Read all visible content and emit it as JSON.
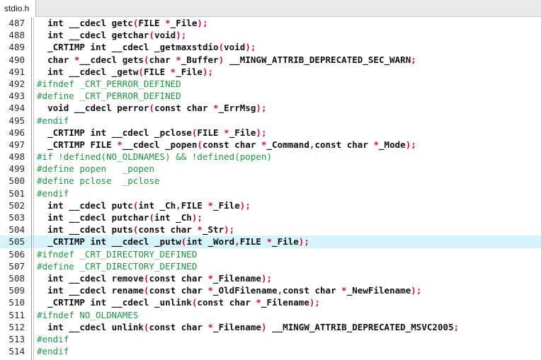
{
  "window": {
    "app": "code-editor",
    "colors": {
      "tabbar_bg": "#e9e9e9",
      "active_tab_bg": "#ffffff",
      "editor_bg": "#ffffff",
      "current_line_highlight": "#d6f4fb",
      "line_number": "#2b2b2b",
      "keyword": "#101010",
      "punctuation": "#d01030",
      "preprocessor": "#1a9641"
    }
  },
  "tabs": [
    {
      "label": "stdio.h",
      "active": true
    }
  ],
  "editor": {
    "language": "c-header",
    "first_visible_line": 487,
    "last_visible_line": 514,
    "current_line": 505,
    "lines": [
      {
        "num": "487",
        "text": "  int __cdecl getc(FILE *_File);"
      },
      {
        "num": "488",
        "text": "  int __cdecl getchar(void);"
      },
      {
        "num": "489",
        "text": "  _CRTIMP int __cdecl _getmaxstdio(void);"
      },
      {
        "num": "490",
        "text": "  char *__cdecl gets(char *_Buffer) __MINGW_ATTRIB_DEPRECATED_SEC_WARN;"
      },
      {
        "num": "491",
        "text": "  int __cdecl _getw(FILE *_File);"
      },
      {
        "num": "492",
        "text": "#ifndef _CRT_PERROR_DEFINED"
      },
      {
        "num": "493",
        "text": "#define _CRT_PERROR_DEFINED"
      },
      {
        "num": "494",
        "text": "  void __cdecl perror(const char *_ErrMsg);"
      },
      {
        "num": "495",
        "text": "#endif"
      },
      {
        "num": "496",
        "text": "  _CRTIMP int __cdecl _pclose(FILE *_File);"
      },
      {
        "num": "497",
        "text": "  _CRTIMP FILE *__cdecl _popen(const char *_Command,const char *_Mode);"
      },
      {
        "num": "498",
        "text": "#if !defined(NO_OLDNAMES) && !defined(popen)"
      },
      {
        "num": "499",
        "text": "#define popen   _popen"
      },
      {
        "num": "500",
        "text": "#define pclose  _pclose"
      },
      {
        "num": "501",
        "text": "#endif"
      },
      {
        "num": "502",
        "text": "  int __cdecl putc(int _Ch,FILE *_File);"
      },
      {
        "num": "503",
        "text": "  int __cdecl putchar(int _Ch);"
      },
      {
        "num": "504",
        "text": "  int __cdecl puts(const char *_Str);"
      },
      {
        "num": "505",
        "text": "  _CRTIMP int __cdecl _putw(int _Word,FILE *_File);"
      },
      {
        "num": "506",
        "text": "#ifndef _CRT_DIRECTORY_DEFINED"
      },
      {
        "num": "507",
        "text": "#define _CRT_DIRECTORY_DEFINED"
      },
      {
        "num": "508",
        "text": "  int __cdecl remove(const char *_Filename);"
      },
      {
        "num": "509",
        "text": "  int __cdecl rename(const char *_OldFilename,const char *_NewFilename);"
      },
      {
        "num": "510",
        "text": "  _CRTIMP int __cdecl _unlink(const char *_Filename);"
      },
      {
        "num": "511",
        "text": "#ifndef NO_OLDNAMES"
      },
      {
        "num": "512",
        "text": "  int __cdecl unlink(const char *_Filename) __MINGW_ATTRIB_DEPRECATED_MSVC2005;"
      },
      {
        "num": "513",
        "text": "#endif"
      },
      {
        "num": "514",
        "text": "#endif"
      }
    ]
  }
}
